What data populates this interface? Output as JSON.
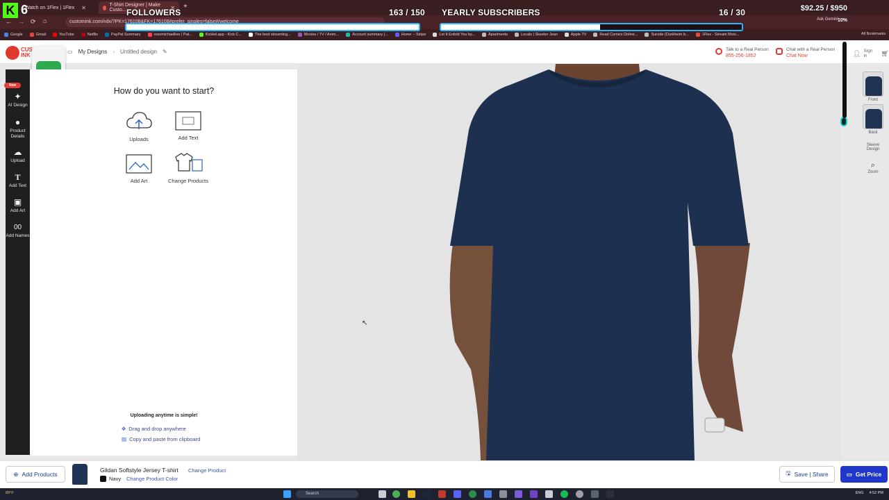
{
  "browser": {
    "tabs": [
      {
        "title": "Watch on 1Flex | 1Flex"
      },
      {
        "title": "T-Shirt Designer | Make Custo..."
      }
    ],
    "new_tab": "+",
    "url": "customink.com/ndx/?PK=176108&FK=176108#prefer_singles=false#/welcome",
    "bookmarks": [
      "Google",
      "Gmail",
      "YouTube",
      "Netflix",
      "PayPal Summary",
      "rosomichaellive | Pat...",
      "Kicklet.app - Kick C...",
      "The best streaming...",
      "Movies / TV / Anim...",
      "Account summary |...",
      "Home -- Stripe",
      "Let It Enfold You by...",
      "Apartments",
      "Locals | Skeeter Jean",
      "Apple TV",
      "Read Comics Online...",
      "Suicide (Durkheim b...",
      "1Flex - Stream Movi..."
    ],
    "all_bookmarks": "All Bookmarks",
    "profile": "Ask Gemini"
  },
  "overlay": {
    "k_logo": "K",
    "k_count": "6",
    "followers_label": "FOLLOWERS",
    "followers_value": "163 / 150",
    "followers_progress": 1.0,
    "subs_label": "YEARLY SUBSCRIBERS",
    "subs_value": "16 / 30",
    "subs_progress": 0.53,
    "donation": "$92.25 / $950",
    "zoom_label": "10%"
  },
  "header": {
    "logo_text": "CUSTOM INK",
    "breadcrumb": {
      "my_designs": "My Designs",
      "current": "Untitled design"
    },
    "talk_label": "Talk to a Real Person",
    "phone": "855-256-1852",
    "chat_label": "Chat with a Real Person",
    "chat_now": "Chat Now",
    "sign_in": "Sign in"
  },
  "rail": {
    "new_badge": "New",
    "items": [
      {
        "label": "AI Design"
      },
      {
        "label": "Product Details"
      },
      {
        "label": "Upload"
      },
      {
        "label": "Add Text"
      },
      {
        "label": "Add Art"
      },
      {
        "label": "Add Names"
      }
    ]
  },
  "panel": {
    "title": "How do you want to start?",
    "options": [
      {
        "label": "Uploads"
      },
      {
        "label": "Add Text"
      },
      {
        "label": "Add Art"
      },
      {
        "label": "Change Products"
      }
    ],
    "upload_heading": "Uploading anytime is simple!",
    "hints": [
      "Drag and drop anywhere",
      "Copy and paste from clipboard"
    ]
  },
  "views": {
    "front": "Front",
    "back": "Back",
    "sleeve": "Sleeve Design",
    "zoom": "Zoom"
  },
  "bottom": {
    "add_products": "Add Products",
    "product_name": "Gildan Softstyle Jersey T-shirt",
    "change_product": "Change Product",
    "color_name": "Navy",
    "change_color": "Change Product Color",
    "save_share": "Save | Share",
    "get_price": "Get Price"
  },
  "taskbar": {
    "search": "Search",
    "weather": "89°F",
    "lang": "ENG",
    "time": "4:52 PM"
  },
  "colors": {
    "shirt": "#1d3050",
    "accent": "#2137c9",
    "brand_red": "#e03a2f"
  }
}
